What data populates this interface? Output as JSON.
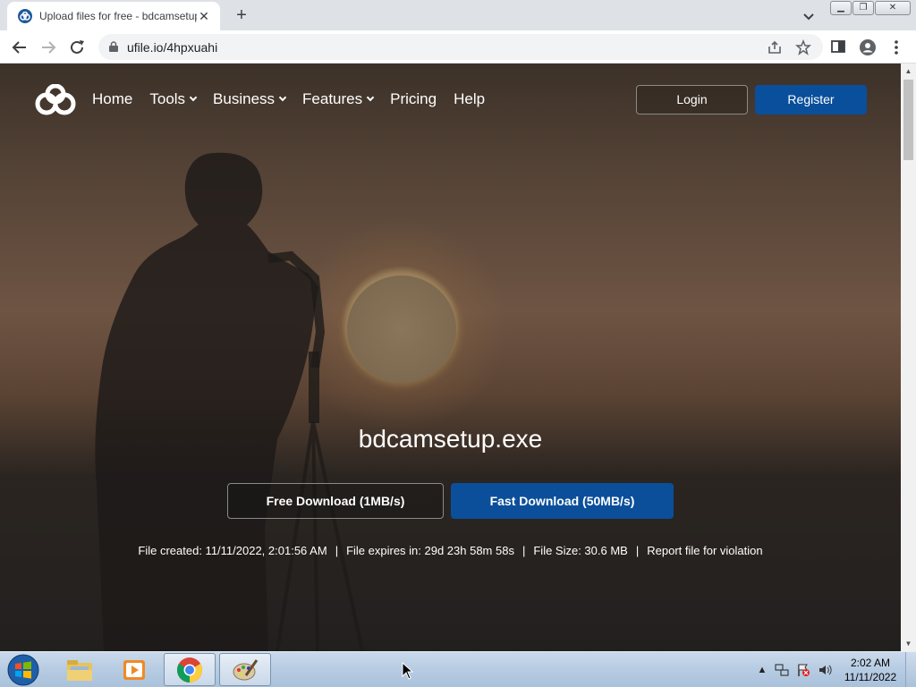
{
  "browser": {
    "tab_title": "Upload files for free - bdcamsetup.exe - ufile.io",
    "url": "ufile.io/4hpxuahi"
  },
  "site": {
    "nav": [
      "Home",
      "Tools",
      "Business",
      "Features",
      "Pricing",
      "Help"
    ],
    "nav_has_dropdown": [
      false,
      true,
      true,
      true,
      false,
      false
    ],
    "login_label": "Login",
    "register_label": "Register"
  },
  "file": {
    "name": "bdcamsetup.exe",
    "free_download_label": "Free Download (1MB/s)",
    "fast_download_label": "Fast Download (50MB/s)",
    "created": "File created: 11/11/2022, 2:01:56 AM",
    "expires": "File expires in: 29d 23h 58m 58s",
    "size": "File Size: 30.6 MB",
    "report": "Report file for violation"
  },
  "taskbar": {
    "time": "2:02 AM",
    "date": "11/11/2022",
    "apps": [
      "windows-explorer",
      "media-player",
      "google-chrome",
      "paint"
    ]
  },
  "colors": {
    "brand_blue": "#0a4f9b",
    "browser_frame": "#dee1e6"
  }
}
